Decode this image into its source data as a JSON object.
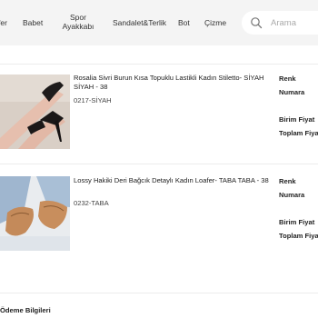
{
  "nav": {
    "items": [
      {
        "label": "fer"
      },
      {
        "label": "Babet"
      },
      {
        "label": "Spor\nAyakkabı"
      },
      {
        "label": "Sandalet&Terlik"
      },
      {
        "label": "Bot"
      },
      {
        "label": "Çizme"
      }
    ],
    "search": {
      "placeholder": "Arama",
      "icon": "search-icon"
    }
  },
  "products": [
    {
      "title": "Rosalia Sivri Burun Kısa Topuklu Lastikli Kadın Stiletto- SİYAH SİYAH - 38",
      "code": "0217-SİYAH",
      "image": "black-pointed-stiletto-photo",
      "attributes": {
        "color_label": "Renk",
        "size_label": "Numara",
        "unit_price_label": "Birim Fiyat",
        "total_price_label": "Toplam Fiyat"
      }
    },
    {
      "title": "Lossy Hakiki Deri Bağcık Detaylı Kadın Loafer- TABA TABA - 38",
      "code": "0232-TABA",
      "image": "tan-loafer-photo",
      "attributes": {
        "color_label": "Renk",
        "size_label": "Numara",
        "unit_price_label": "Birim Fiyat",
        "total_price_label": "Toplam Fiyat"
      }
    }
  ],
  "payment": {
    "section_title": "Ödeme Bilgileri"
  }
}
